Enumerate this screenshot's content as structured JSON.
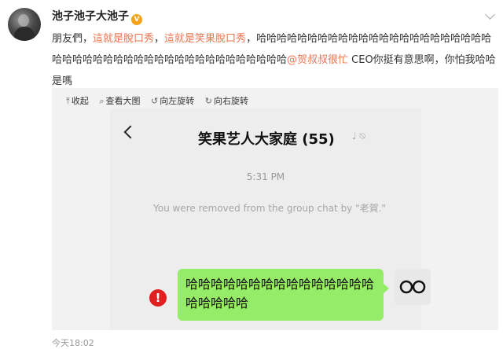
{
  "author": {
    "name": "池子池子大池子",
    "badge_icon": "vip-badge-icon",
    "badge_color": "#f7a21b"
  },
  "post": {
    "text_1": "朋友們，",
    "highlight_1": "這就是脫口秀",
    "text_2": "，",
    "highlight_2": "這就是笑果脫口秀",
    "text_3": "，哈哈哈哈哈哈哈哈哈哈哈哈哈哈哈哈哈哈哈哈哈哈哈哈哈哈哈哈哈哈哈哈哈哈哈哈哈哈哈哈哈哈哈哈哈哈",
    "mention": "@贺叔叔很忙",
    "text_4": " CEO你挺有意思啊，你怕我哈哈是嗎",
    "link_color": "#eb7350"
  },
  "image_toolbar": {
    "collapse": "收起",
    "view_large": "查看大图",
    "rotate_left": "向左旋转",
    "rotate_right": "向右旋转"
  },
  "screenshot": {
    "chat_title": "笑果艺人大家庭 (55)",
    "time": "5:31 PM",
    "removed_notice": "You were removed from the group chat by \"老賀.\"",
    "message": "哈哈哈哈哈哈哈哈哈哈哈哈哈哈哈哈哈哈哈哈",
    "bubble_color": "#95ec69",
    "error_color": "#e02020"
  },
  "timestamp": "今天18:02"
}
